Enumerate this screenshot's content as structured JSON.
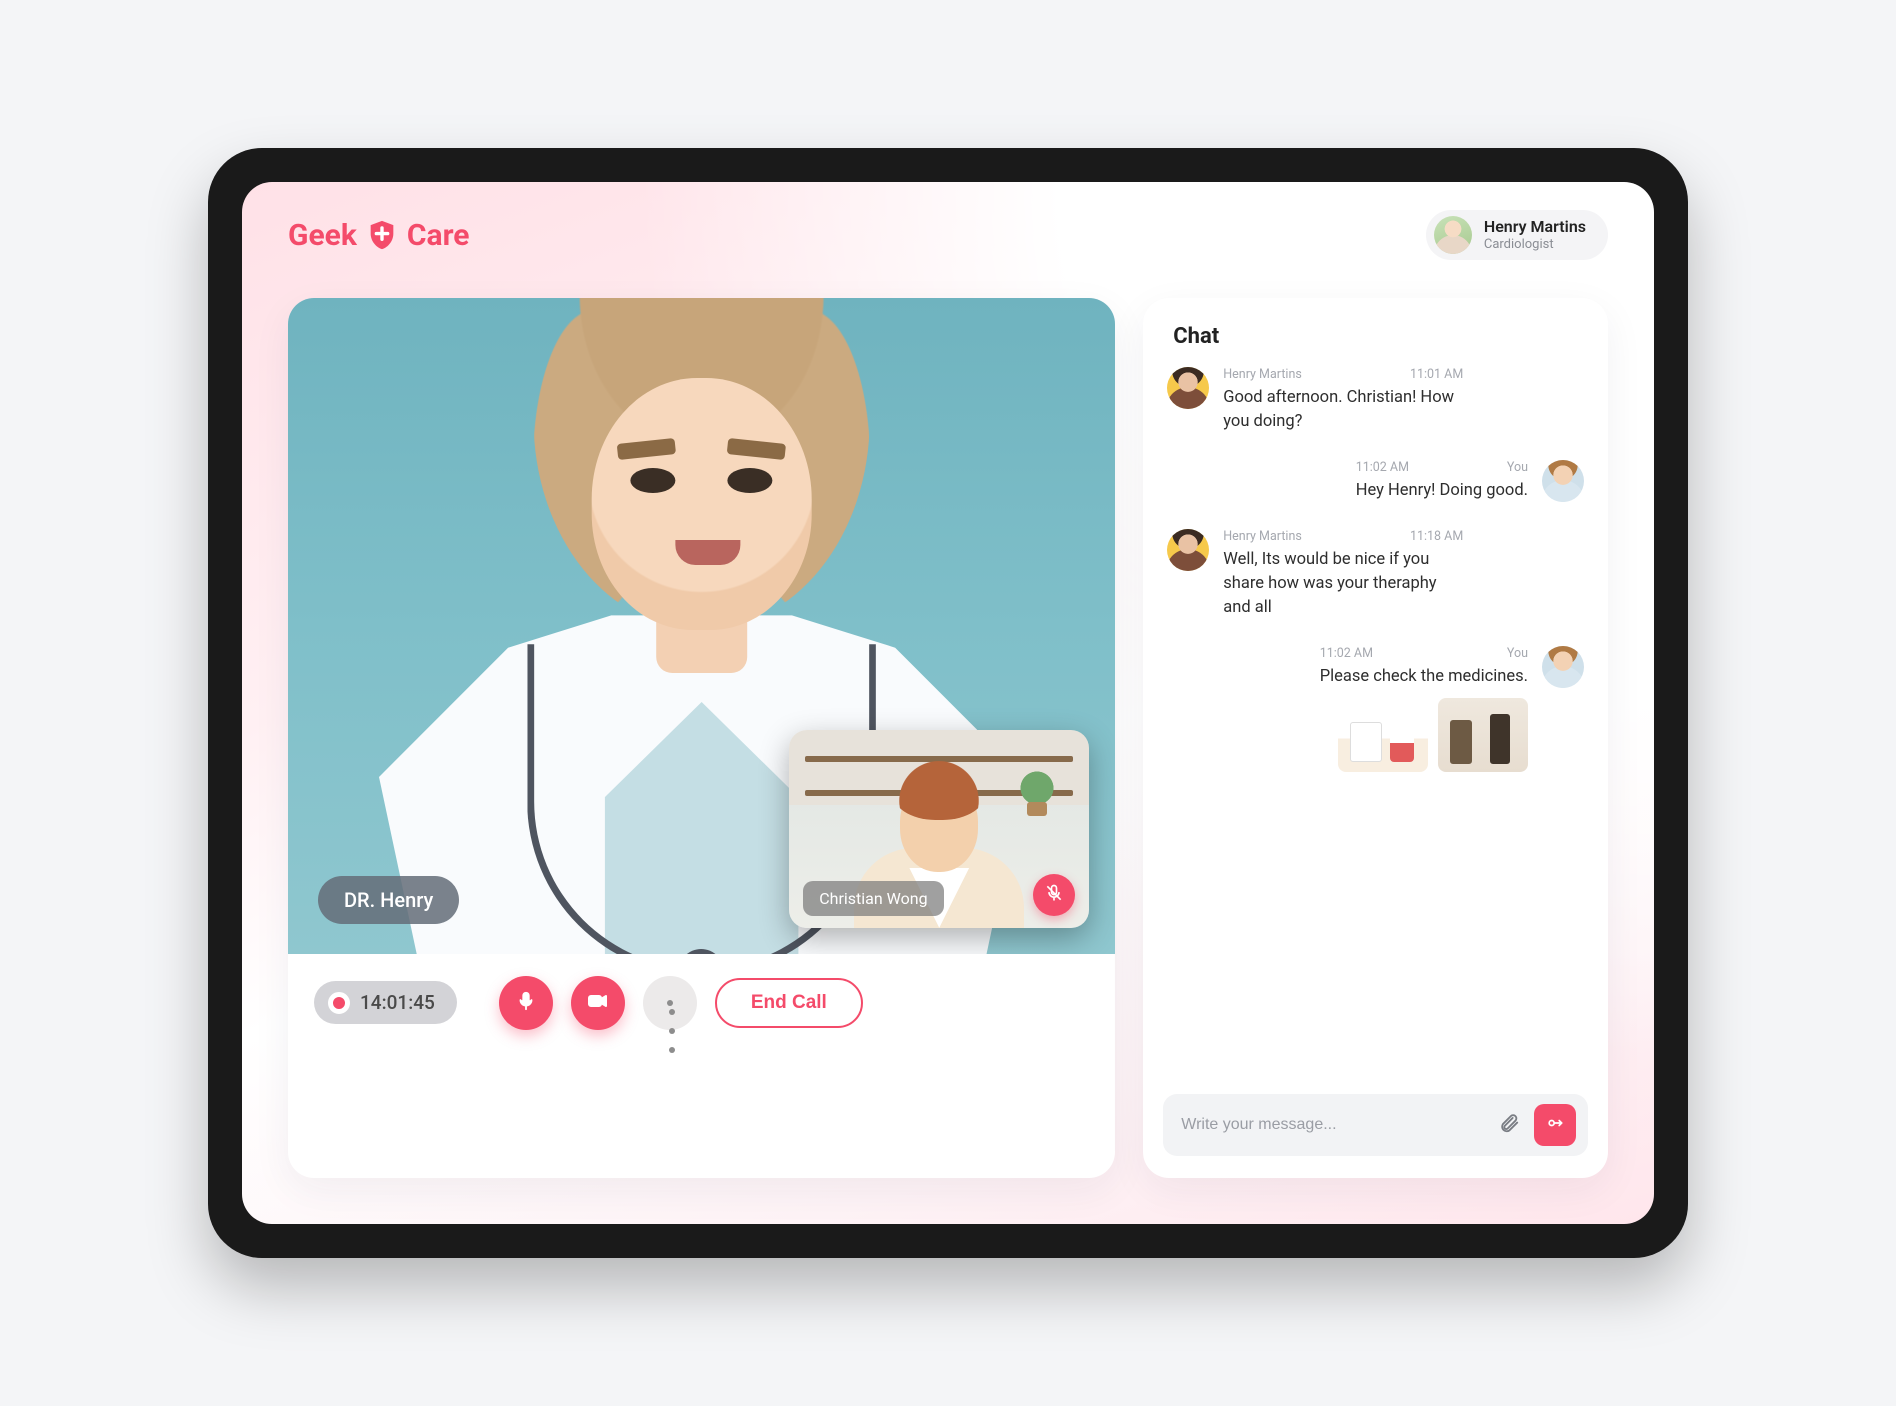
{
  "brand": {
    "prefix": "Geek",
    "suffix": "Care",
    "accent": "#f44b6a"
  },
  "account": {
    "name": "Henry Martins",
    "role": "Cardiologist"
  },
  "video": {
    "main_participant_label": "DR. Henry",
    "pip_participant_label": "Christian Wong",
    "pip_mic_muted": true
  },
  "controls": {
    "recording_time": "14:01:45",
    "end_call_label": "End Call"
  },
  "chat": {
    "title": "Chat",
    "messages": [
      {
        "side": "them",
        "sender": "Henry Martins",
        "time": "11:01 AM",
        "text": "Good afternoon. Christian! How you doing?"
      },
      {
        "side": "me",
        "sender": "You",
        "time": "11:02 AM",
        "text": "Hey Henry! Doing good."
      },
      {
        "side": "them",
        "sender": "Henry Martins",
        "time": "11:18 AM",
        "text": "Well, Its would be nice if you share how was your theraphy and all"
      },
      {
        "side": "me",
        "sender": "You",
        "time": "11:02 AM",
        "text": "Please check the medicines.",
        "attachments": 2
      }
    ],
    "composer_placeholder": "Write your message..."
  }
}
